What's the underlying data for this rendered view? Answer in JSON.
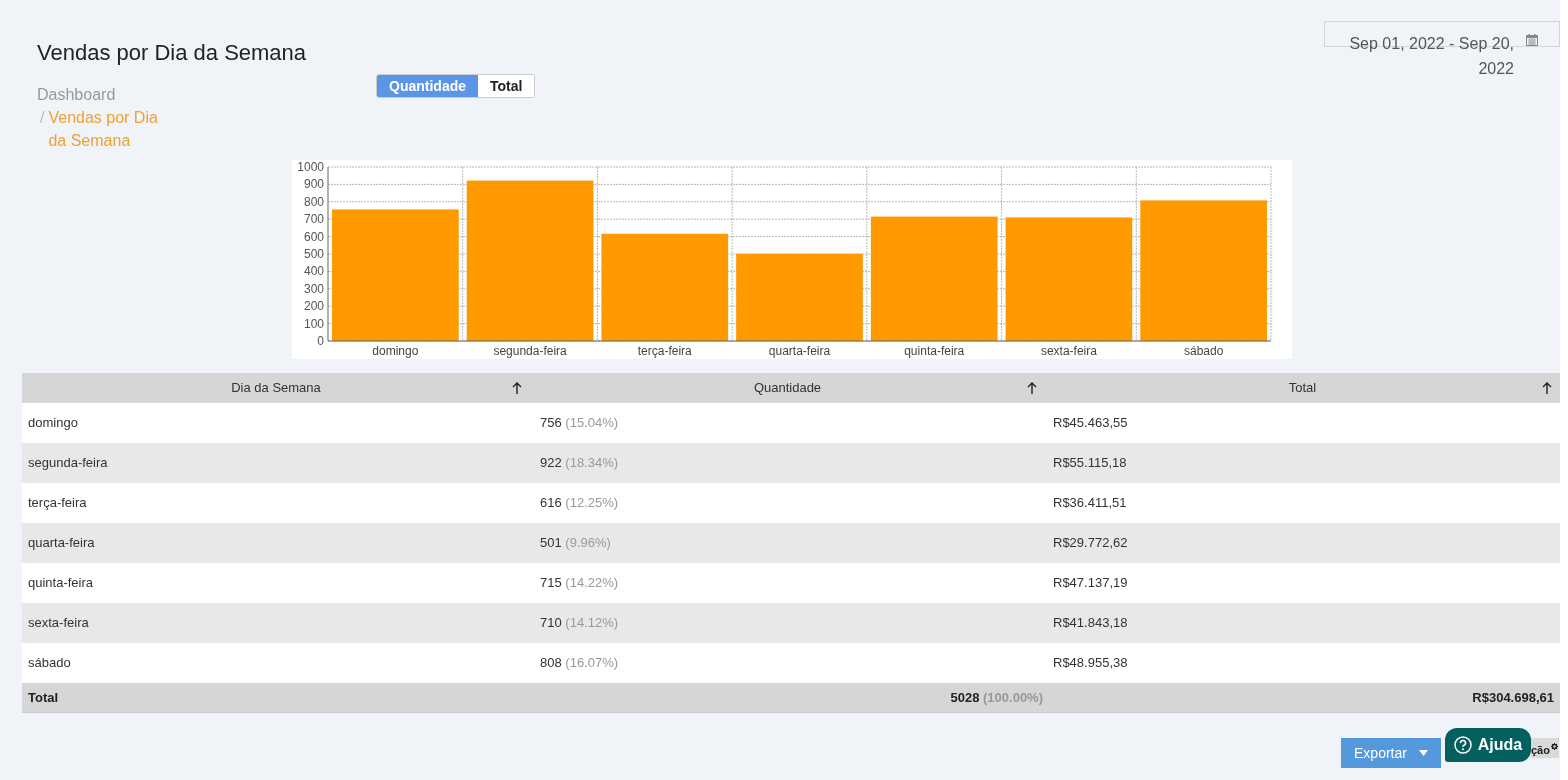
{
  "page": {
    "title": "Vendas por Dia da Semana"
  },
  "breadcrumb": [
    {
      "label": "Dashboard",
      "current": false
    },
    {
      "label": "Vendas por Dia da Semana",
      "separator": "/",
      "current": true
    }
  ],
  "date_range": {
    "value": "Sep 01, 2022 - Sep 20, 2022"
  },
  "toggle": [
    {
      "label": "Quantidade",
      "selected": true
    },
    {
      "label": "Total",
      "selected": false
    }
  ],
  "chart_data": {
    "type": "bar",
    "categories": [
      "domingo",
      "segunda-feira",
      "terça-feira",
      "quarta-feira",
      "quinta-feira",
      "sexta-feira",
      "sábado"
    ],
    "values": [
      756,
      922,
      616,
      501,
      715,
      710,
      808
    ],
    "grid": true,
    "ylim": [
      0,
      1000
    ],
    "yticks": [
      0,
      100,
      200,
      300,
      400,
      500,
      600,
      700,
      800,
      900,
      1000
    ]
  },
  "table": {
    "columns": [
      "Dia da Semana",
      "Quantidade",
      "Total"
    ],
    "rows": [
      {
        "day": "domingo",
        "qty": "756",
        "pct": "(15.04%)",
        "total": "R$45.463,55"
      },
      {
        "day": "segunda-feira",
        "qty": "922",
        "pct": "(18.34%)",
        "total": "R$55.115,18"
      },
      {
        "day": "terça-feira",
        "qty": "616",
        "pct": "(12.25%)",
        "total": "R$36.411,51"
      },
      {
        "day": "quarta-feira",
        "qty": "501",
        "pct": "(9.96%)",
        "total": "R$29.772,62"
      },
      {
        "day": "quinta-feira",
        "qty": "715",
        "pct": "(14.22%)",
        "total": "R$47.137,19"
      },
      {
        "day": "sexta-feira",
        "qty": "710",
        "pct": "(14.12%)",
        "total": "R$41.843,18"
      },
      {
        "day": "sábado",
        "qty": "808",
        "pct": "(16.07%)",
        "total": "R$48.955,38"
      }
    ],
    "footer": {
      "label": "Total",
      "qty": "5028",
      "pct": "(100.00%)",
      "total": "R$304.698,61"
    }
  },
  "buttons": {
    "export": "Exportar",
    "partial": "ção",
    "help": "Ajuda"
  }
}
